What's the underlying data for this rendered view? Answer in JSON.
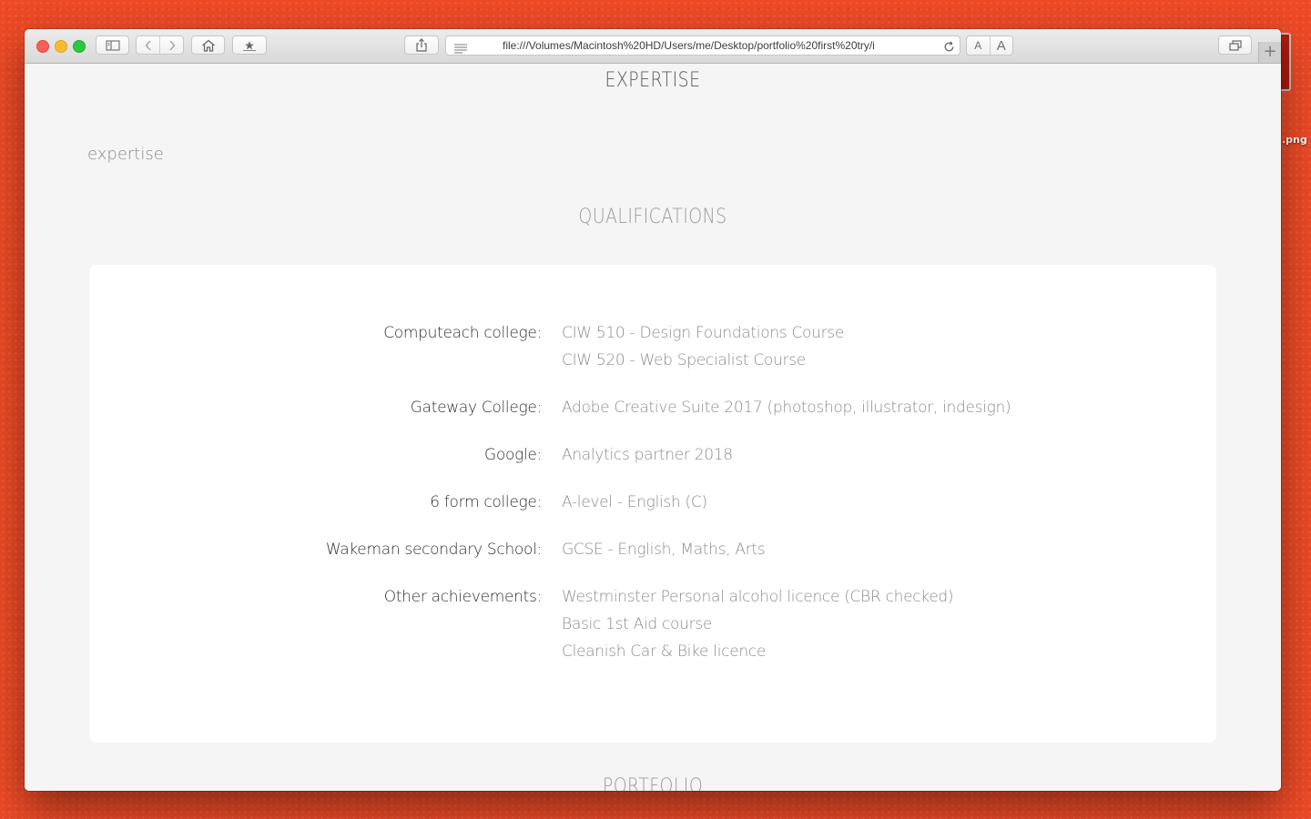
{
  "desktop": {
    "file_label": ".png"
  },
  "browser": {
    "url": "file:///Volumes/Macintosh%20HD/Users/me/Desktop/portfolio%20first%20try/i",
    "font_small_label": "A",
    "font_large_label": "A",
    "new_tab_label": "+"
  },
  "page": {
    "expertise_title": "EXPERTISE",
    "expertise_text": "expertise",
    "qualifications_title": "QUALIFICATIONS",
    "next_section_title": "PORTFOLIO",
    "qualifications": [
      {
        "institution": "Computeach college:",
        "items": [
          "CIW 510 - Design Foundations Course",
          "CIW 520 - Web Specialist Course"
        ]
      },
      {
        "institution": "Gateway College:",
        "items": [
          "Adobe Creative Suite 2017 (photoshop, illustrator, indesign)"
        ]
      },
      {
        "institution": "Google:",
        "items": [
          "Analytics partner 2018"
        ]
      },
      {
        "institution": "6 form college:",
        "items": [
          "A-level - English (C)"
        ]
      },
      {
        "institution": "Wakeman secondary School:",
        "items": [
          "GCSE - English, Maths, Arts"
        ]
      },
      {
        "institution": "Other achievements:",
        "items": [
          "Westminster Personal alcohol licence (CBR checked)",
          "Basic 1st Aid course",
          "Cleanish Car & Bike licence"
        ]
      }
    ]
  }
}
